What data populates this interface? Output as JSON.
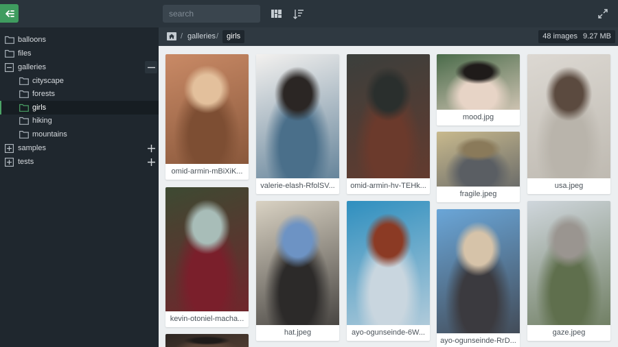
{
  "app": {
    "colors": {
      "accent": "#3f9c5f",
      "sidebar_bg": "#1f272e",
      "topbar_bg": "#2a343c",
      "gallery_bg": "#eceff1"
    }
  },
  "toolbar": {
    "search_placeholder": "search",
    "icons": [
      "menu-collapse-icon",
      "layout-icon",
      "sort-icon",
      "fullscreen-icon"
    ]
  },
  "sidebar": {
    "items": [
      {
        "label": "balloons",
        "level": 0,
        "state": "closed"
      },
      {
        "label": "files",
        "level": 0,
        "state": "closed"
      },
      {
        "label": "galleries",
        "level": 0,
        "state": "open",
        "action": "−"
      },
      {
        "label": "cityscape",
        "level": 1,
        "state": "closed"
      },
      {
        "label": "forests",
        "level": 1,
        "state": "closed"
      },
      {
        "label": "girls",
        "level": 1,
        "state": "active"
      },
      {
        "label": "hiking",
        "level": 1,
        "state": "closed"
      },
      {
        "label": "mountains",
        "level": 1,
        "state": "closed"
      },
      {
        "label": "samples",
        "level": 0,
        "state": "expandable",
        "action": "+"
      },
      {
        "label": "tests",
        "level": 0,
        "state": "expandable",
        "action": "+"
      }
    ]
  },
  "breadcrumb": {
    "sep": "/",
    "items": [
      "galleries",
      "girls"
    ],
    "image_count": "48 images",
    "total_size": "9.27 MB"
  },
  "gallery": {
    "items": [
      {
        "caption": "omid-armin-mBiXiK...",
        "colors": [
          "#c98a66",
          "#7d4e33",
          "#e3c09c"
        ]
      },
      {
        "caption": "valerie-elash-RfolSV...",
        "colors": [
          "#f3f1ef",
          "#4a6f8a",
          "#2b2624"
        ]
      },
      {
        "caption": "omid-armin-hv-TEHk...",
        "colors": [
          "#3b3f3c",
          "#6b3a2c",
          "#2a2f2d"
        ]
      },
      {
        "caption": "mood.jpg",
        "colors": [
          "#4a6b4a",
          "#e7d4c6",
          "#1f1b1a"
        ]
      },
      {
        "caption": "usa.jpeg",
        "colors": [
          "#dcd8d2",
          "#b9b4ab",
          "#5b4a3f"
        ]
      },
      {
        "caption": "fragile.jpeg",
        "colors": [
          "#c8b98d",
          "#5a5e63",
          "#8a7a5a"
        ]
      },
      {
        "caption": "kevin-otoniel-macha...",
        "colors": [
          "#3d4a32",
          "#7a1f2b",
          "#a8bdb8"
        ]
      },
      {
        "caption": "hat.jpeg",
        "colors": [
          "#d9d2c3",
          "#2c2a29",
          "#6d93c4"
        ]
      },
      {
        "caption": "ayo-ogunseinde-6W...",
        "colors": [
          "#2f8fbf",
          "#c9d6df",
          "#8b3a24"
        ]
      },
      {
        "caption": "ayo-ogunseinde-RrD...",
        "colors": [
          "#6aa6d8",
          "#3b3a3f",
          "#d6c3a9"
        ]
      },
      {
        "caption": "gaze.jpeg",
        "colors": [
          "#cfd6dc",
          "#5f6f4d",
          "#9a9590"
        ]
      },
      {
        "caption": "",
        "colors": [
          "#2d2622",
          "#5b4437",
          "#1f1b19"
        ]
      }
    ]
  }
}
